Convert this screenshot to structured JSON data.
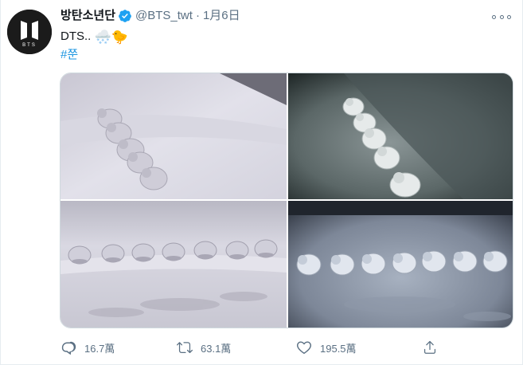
{
  "tweet": {
    "display_name": "방탄소년단",
    "verified_icon": "verified-badge-icon",
    "handle": "@BTS_twt",
    "separator": "·",
    "date": "1月6日",
    "text": "DTS..",
    "emojis": "🌨️🐤",
    "hashtag": "#쭌"
  },
  "avatar": {
    "logo_text": "BTS"
  },
  "media": {
    "photos": [
      {
        "icon": "snow-ducks-photo-1"
      },
      {
        "icon": "snow-ducks-photo-2"
      },
      {
        "icon": "snow-ducks-photo-3"
      },
      {
        "icon": "snow-ducks-photo-4"
      }
    ]
  },
  "actions": {
    "reply_count": "16.7萬",
    "retweet_count": "63.1萬",
    "like_count": "195.5萬",
    "share_icon": "share-icon"
  },
  "colors": {
    "link": "#1b95e0",
    "secondary_text": "#5b7083",
    "verified": "#1da1f2"
  }
}
